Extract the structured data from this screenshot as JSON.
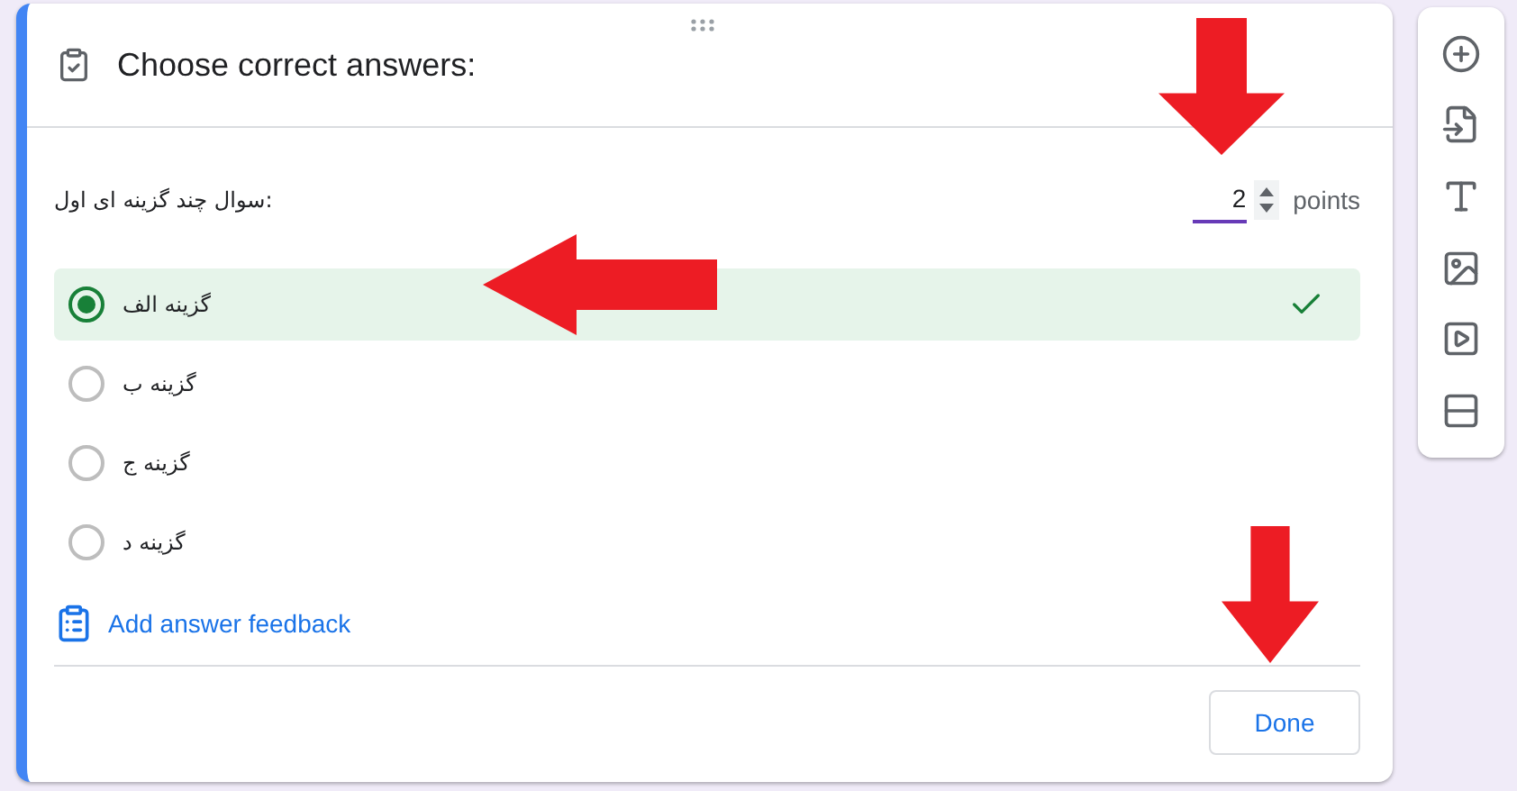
{
  "card": {
    "title": "Choose correct answers:"
  },
  "question": {
    "text": "سوال چند گزینه ای اول:",
    "points_value": "2",
    "points_label": "points"
  },
  "options": [
    {
      "label": "گزینه الف",
      "selected": true
    },
    {
      "label": "گزینه ب",
      "selected": false
    },
    {
      "label": "گزینه ج",
      "selected": false
    },
    {
      "label": "گزینه د",
      "selected": false
    }
  ],
  "feedback_link": "Add answer feedback",
  "done_button": "Done",
  "annotation_arrows": [
    {
      "kind": "down"
    },
    {
      "kind": "left"
    },
    {
      "kind": "down"
    }
  ]
}
